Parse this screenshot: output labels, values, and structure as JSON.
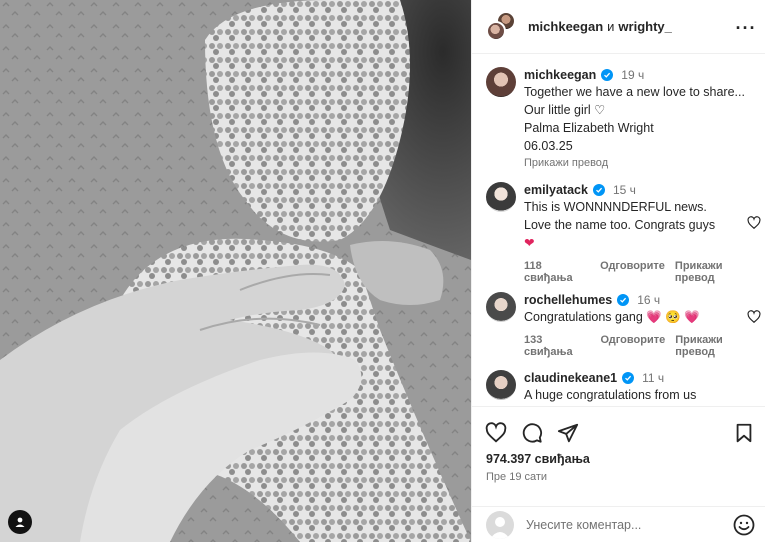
{
  "post": {
    "author": "michkeegan",
    "conjunction": "и",
    "collaborator": "wrighty_",
    "likes": "974.397 свиђања",
    "time_ago": "Пре 19 сати"
  },
  "caption": {
    "username": "michkeegan",
    "time": "19 ч",
    "lines": [
      "Together we have a new love to share...",
      "Our little girl ♡",
      "Palma Elizabeth Wright",
      "06.03.25"
    ],
    "translate_label": "Прикажи превод"
  },
  "comments": [
    {
      "username": "emilyatack",
      "time": "15 ч",
      "lines": [
        "This is WONNNNDERFUL news.",
        "Love the name too. Congrats guys"
      ],
      "emoji": "❤",
      "likes": "118 свиђања",
      "reply_label": "Одговорите",
      "translate_label": "Прикажи превод"
    },
    {
      "username": "rochellehumes",
      "time": "16 ч",
      "text": "Congratulations gang",
      "emoji": "💗 🥺 💗",
      "likes": "133 свиђања",
      "reply_label": "Одговорите",
      "translate_label": "Прикажи превод"
    },
    {
      "username": "claudinekeane1",
      "time": "11 ч",
      "text": "A huge congratulations from us"
    }
  ],
  "comment_input": {
    "placeholder": "Унесите коментар..."
  },
  "icons": [
    "more-icon",
    "heart-icon",
    "comment-icon",
    "share-icon",
    "save-icon",
    "emoji-icon",
    "verified-icon",
    "user-tag-icon"
  ],
  "colors": {
    "verified": "#0095f6",
    "muted": "#737373",
    "text": "#262626",
    "border": "#efefef"
  }
}
